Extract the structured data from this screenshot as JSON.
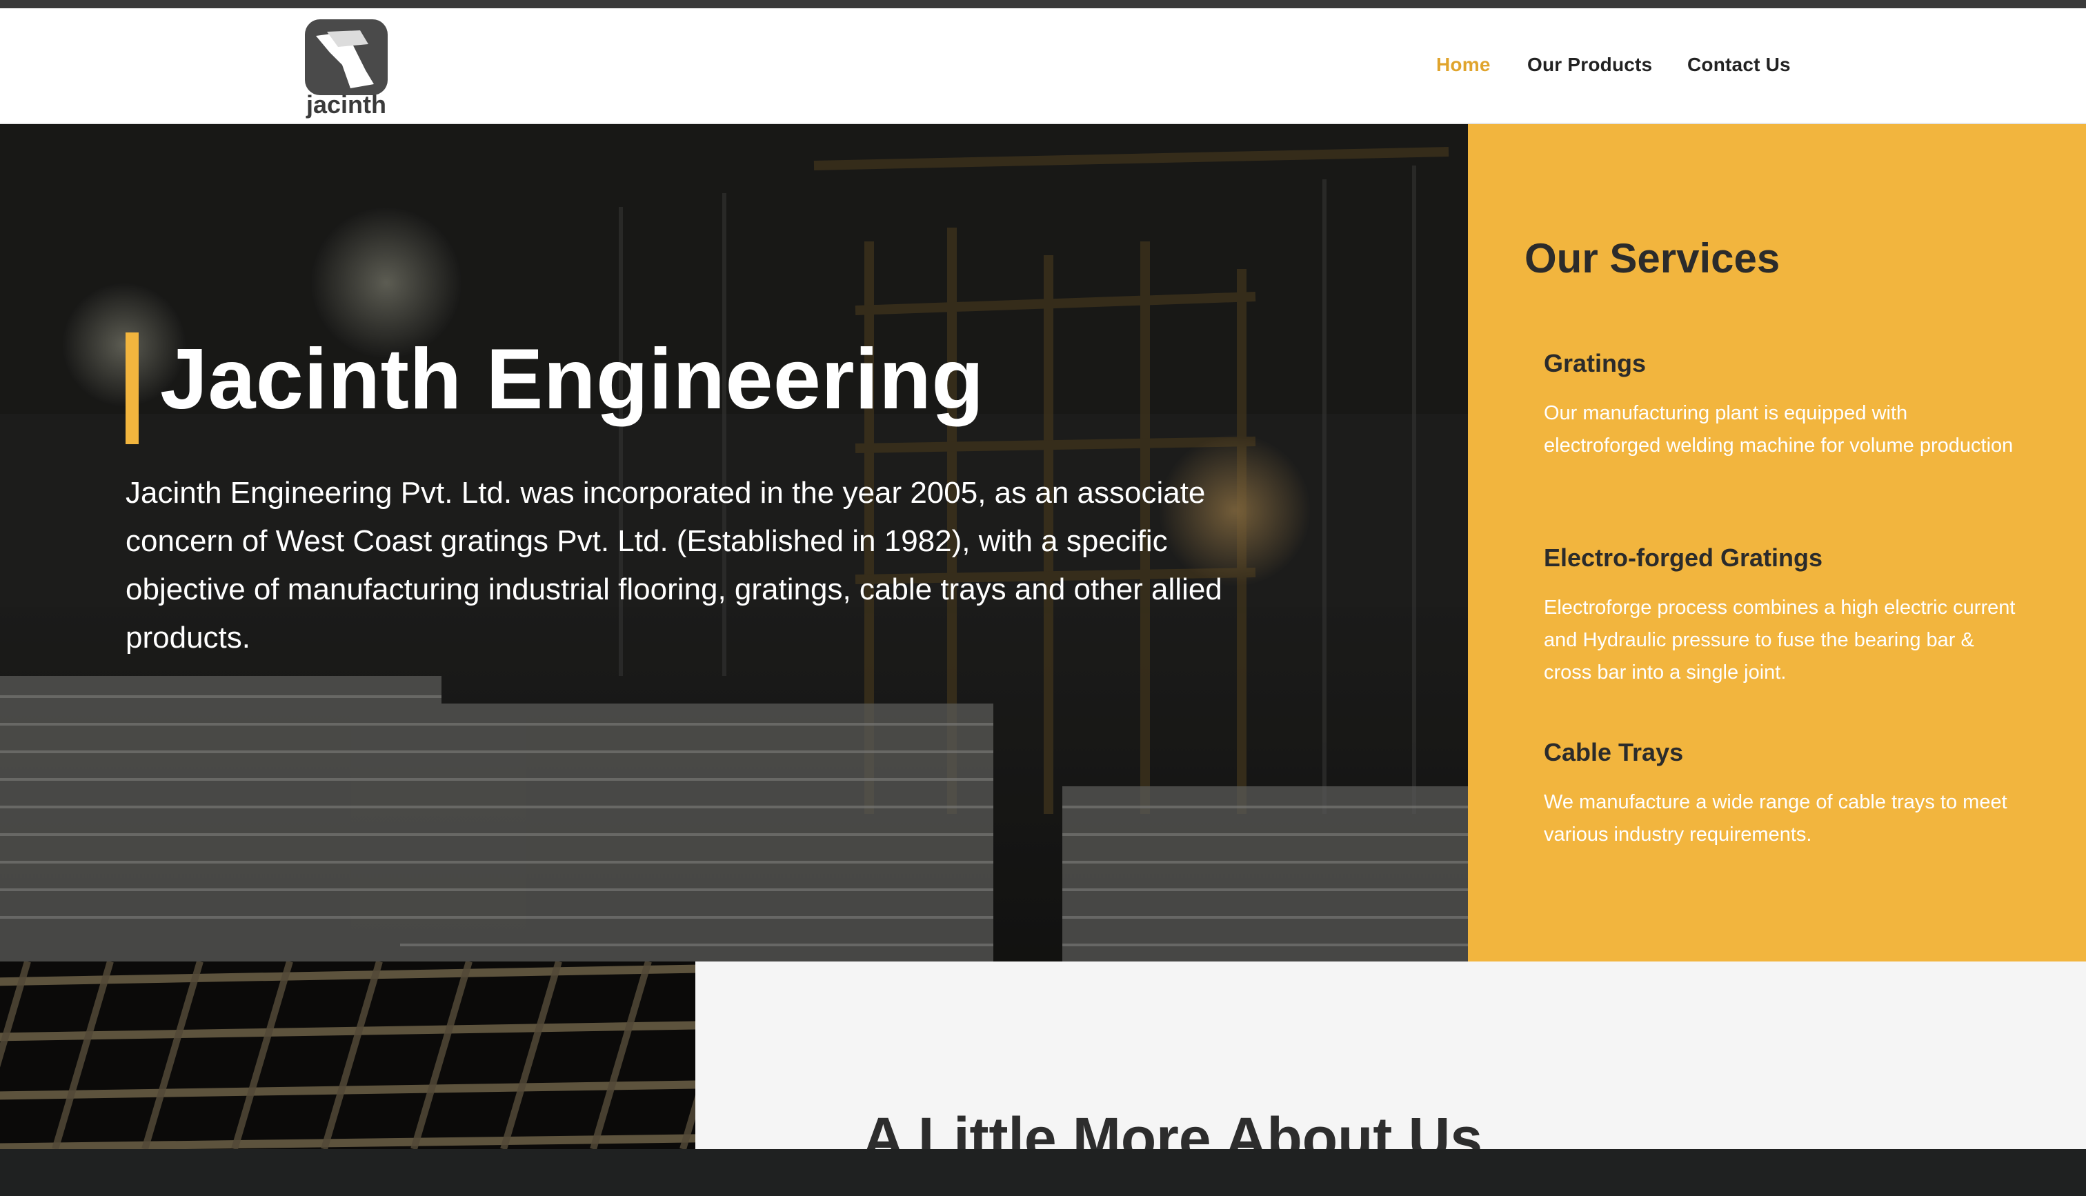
{
  "header": {
    "logo_text": "jacinth",
    "nav": [
      {
        "label": "Home",
        "active": true
      },
      {
        "label": "Our Products",
        "active": false
      },
      {
        "label": "Contact Us",
        "active": false
      }
    ]
  },
  "hero": {
    "title": "Jacinth Engineering",
    "description": "Jacinth Engineering Pvt. Ltd. was incorporated in the year 2005, as an associate concern of West Coast gratings Pvt. Ltd. (Established in 1982), with a specific objective of manufacturing industrial flooring, gratings, cable trays and other allied products."
  },
  "services": {
    "title": "Our Services",
    "items": [
      {
        "title": "Gratings",
        "text": "Our manufacturing plant is equipped with electroforged welding machine for volume production"
      },
      {
        "title": "Electro-forged Gratings",
        "text": "Electroforge process combines a high electric current and Hydraulic pressure to fuse the bearing bar & cross bar into a single joint."
      },
      {
        "title": "Cable Trays",
        "text": "We manufacture a wide range of cable trays to meet various industry requirements."
      }
    ]
  },
  "about": {
    "title": "A Little More About Us"
  },
  "colors": {
    "accent": "#f2b53e",
    "nav_active": "#e0a42c",
    "dark_text": "#2b2b2b",
    "topbar": "#3a3a3a",
    "footer": "#1f2121"
  }
}
